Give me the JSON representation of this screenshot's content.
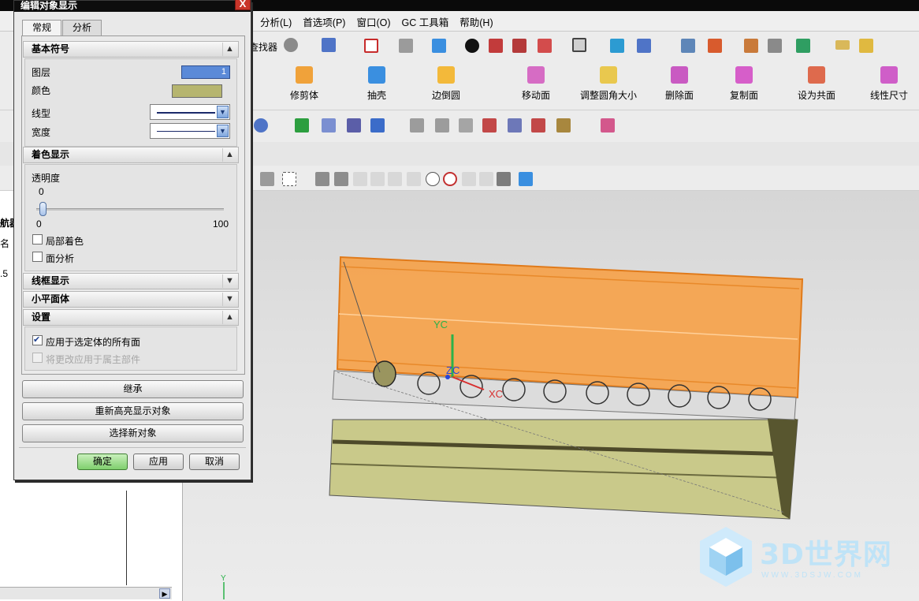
{
  "dialog": {
    "title": "编辑对象显示",
    "close_glyph": "X",
    "tabs": [
      {
        "label": "常规",
        "active": true
      },
      {
        "label": "分析",
        "active": false
      }
    ],
    "sections": {
      "basic": {
        "header": "基本符号",
        "layer_label": "图层",
        "layer_value": "1",
        "color_label": "颜色",
        "color_value": "#b6b56f",
        "linetype_label": "线型",
        "width_label": "宽度"
      },
      "shaded": {
        "header": "着色显示",
        "transparency_label": "透明度",
        "transparency_value": "0",
        "slider_min": "0",
        "slider_max": "100",
        "partial_shading_label": "局部着色",
        "face_analysis_label": "面分析"
      },
      "wireframe": {
        "header": "线框显示"
      },
      "facet": {
        "header": "小平面体"
      },
      "settings": {
        "header": "设置",
        "apply_all_faces_label": "应用于选定体的所有面",
        "apply_all_faces_checked": true,
        "apply_owner_label": "将更改应用于属主部件",
        "apply_owner_checked": false
      }
    },
    "buttons": {
      "inherit": "继承",
      "rehighlight": "重新高亮显示对象",
      "select_new": "选择新对象",
      "ok": "确定",
      "apply": "应用",
      "cancel": "取消"
    }
  },
  "menubar": {
    "items": [
      "分析(L)",
      "首选项(P)",
      "窗口(O)",
      "GC 工具箱",
      "帮助(H)"
    ]
  },
  "toolbar": {
    "finder_label": "查找器",
    "sync_buttons": [
      {
        "label": "修剪体"
      },
      {
        "label": "抽壳"
      },
      {
        "label": "边倒圆"
      },
      {
        "label": "移动面"
      },
      {
        "label": "调整圆角大小"
      },
      {
        "label": "删除面"
      },
      {
        "label": "复制面"
      },
      {
        "label": "设为共面"
      },
      {
        "label": "线性尺寸"
      }
    ]
  },
  "navigator": {
    "partial_labels": [
      "航器",
      "名",
      ".5"
    ]
  },
  "viewport": {
    "axis_yc": "YC",
    "axis_zc": "ZC",
    "axis_xc": "XC",
    "triad_y": "Y"
  },
  "watermark": {
    "brand": "3D世界网",
    "url": "WWW.3DSJW.COM"
  },
  "colors": {
    "accent_orange": "#f5a24a",
    "body_olive": "#c9c98a",
    "ok_green": "#7fcf6d"
  }
}
